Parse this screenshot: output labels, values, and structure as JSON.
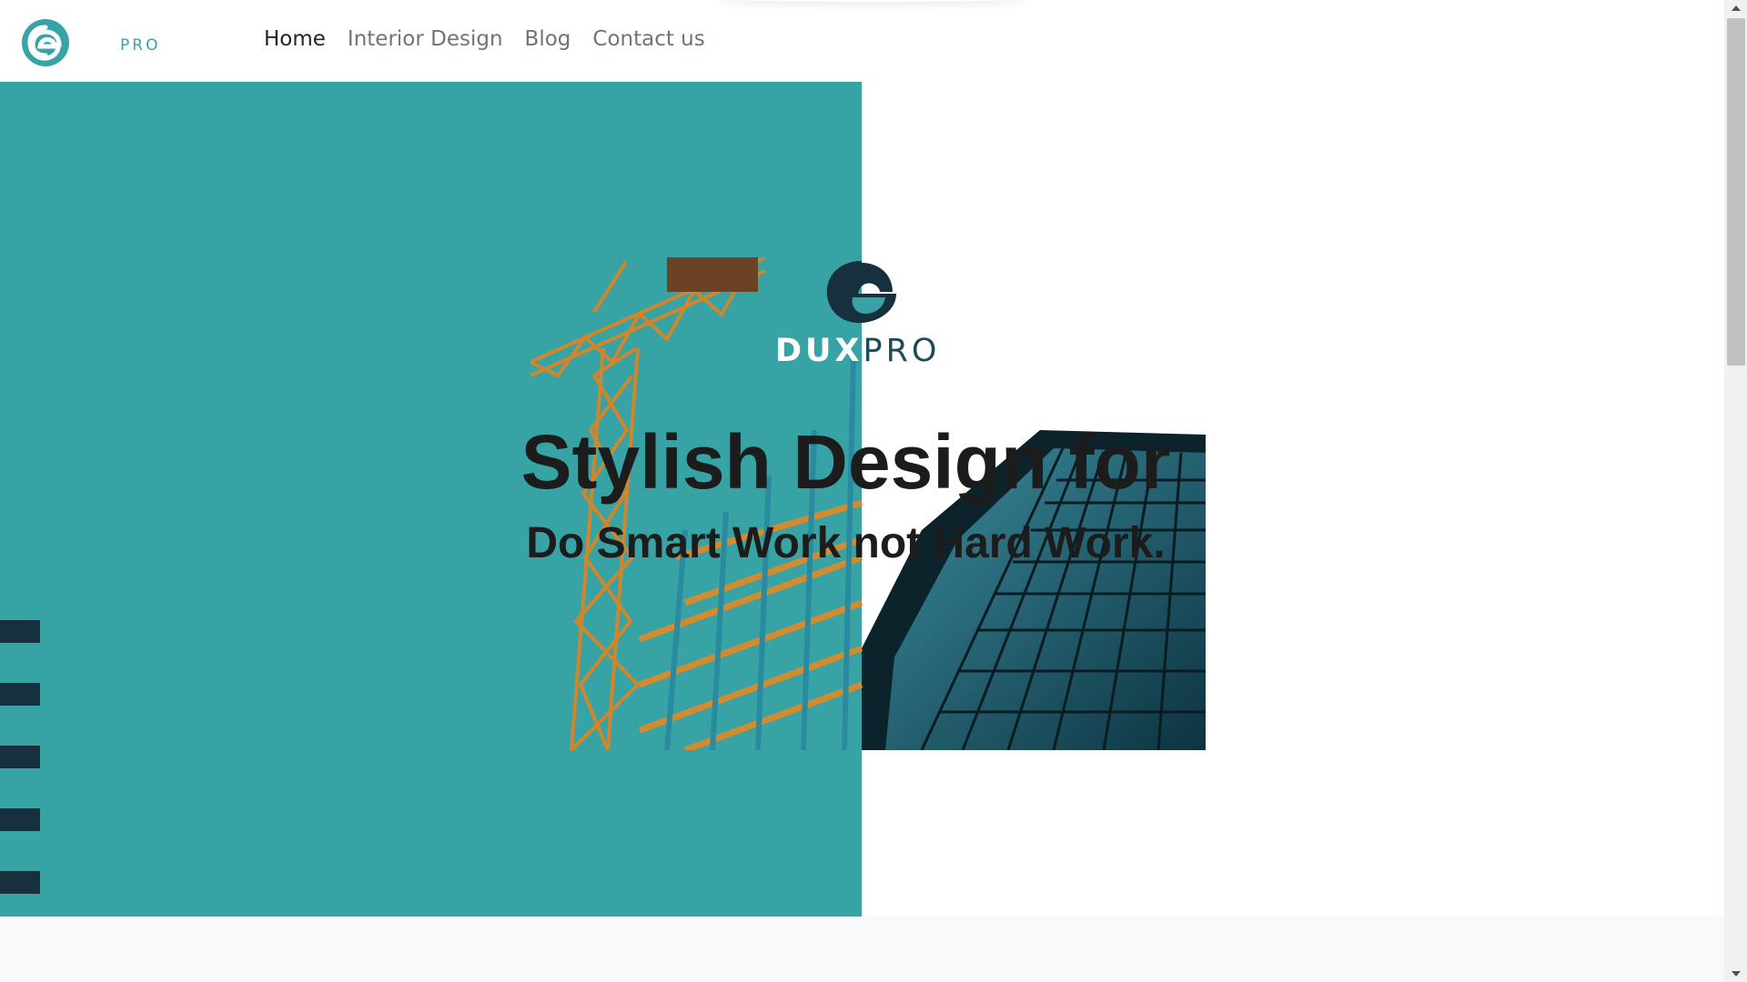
{
  "brand": {
    "name_suffix": "PRO",
    "logo_icon": "swirl-e-logo-icon",
    "accent_color": "#38a3a5",
    "dark_color": "#16313d"
  },
  "nav": {
    "items": [
      {
        "label": "Home",
        "active": true
      },
      {
        "label": "Interior Design",
        "active": false
      },
      {
        "label": "Blog",
        "active": false
      },
      {
        "label": "Contact us",
        "active": false
      }
    ]
  },
  "hero": {
    "logo_dux": "DUX",
    "logo_pro": "PRO",
    "title": "Stylish Design for",
    "subtitle": "Do Smart Work not Hard Work.",
    "slide_indicator_count": 5,
    "image_icon": "construction-crane-and-skyscraper-image"
  }
}
